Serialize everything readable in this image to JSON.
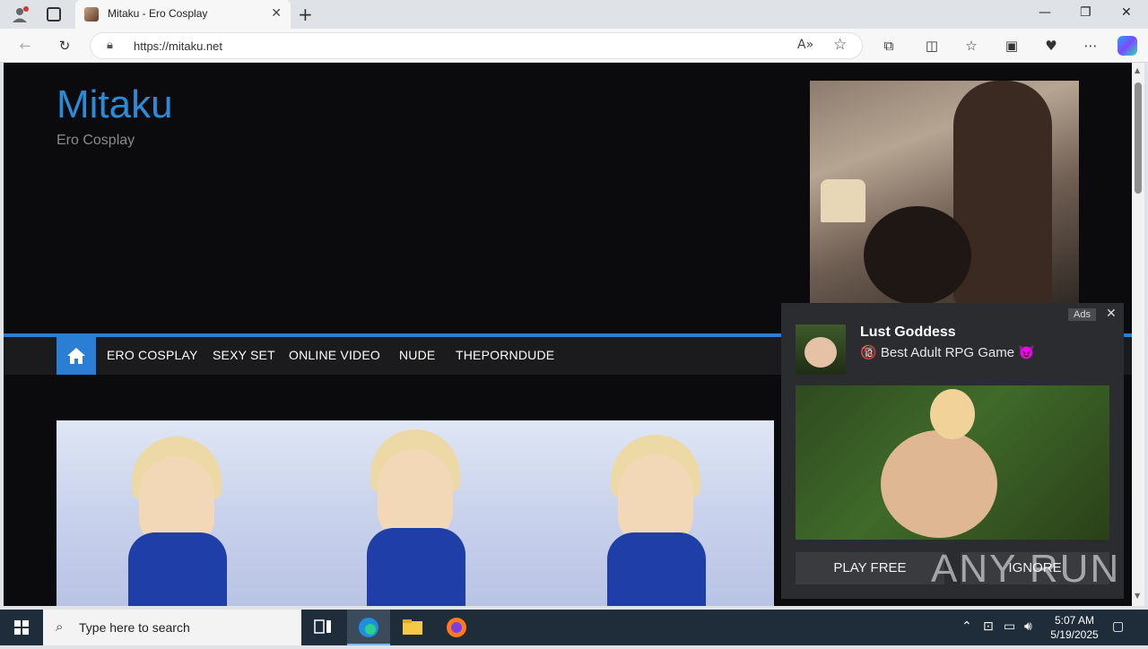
{
  "browser": {
    "tab_title": "Mitaku - Ero Cosplay",
    "url": "https://mitaku.net",
    "window_controls": [
      "minimize",
      "restore",
      "close"
    ]
  },
  "site": {
    "title": "Mitaku",
    "subtitle": "Ero Cosplay",
    "nav": [
      "ERO COSPLAY",
      "SEXY SET",
      "ONLINE VIDEO",
      "NUDE",
      "THEPORNDUDE"
    ]
  },
  "ad": {
    "badge": "Ads",
    "title": "Lust Goddess",
    "description_prefix": "🔞",
    "description": "Best Adult RPG Game",
    "description_suffix": "😈",
    "buttons": [
      "PLAY FREE",
      "IGNORE"
    ]
  },
  "watermark": "ANY RUN",
  "taskbar": {
    "search_placeholder": "Type here to search",
    "time": "5:07 AM",
    "date": "5/19/2025"
  },
  "colors": {
    "accent": "#2a7fd4",
    "site_title": "#2a8bd8",
    "page_bg": "#0b0b0d"
  }
}
